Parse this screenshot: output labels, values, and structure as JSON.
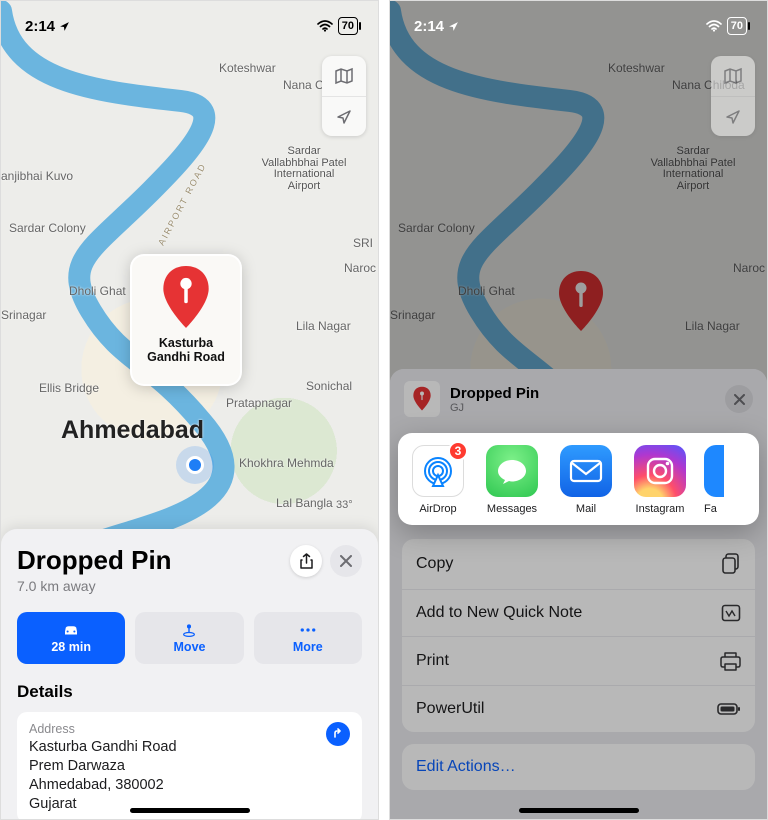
{
  "status": {
    "time": "2:14",
    "battery": "70"
  },
  "map": {
    "city": "Ahmedabad",
    "pin_label_1": "Kasturba",
    "pin_label_2": "Gandhi Road",
    "temp": "33°",
    "airport_label": "Sardar Vallabhbhai Patel International Airport",
    "airport_road": "AIRPORT ROAD",
    "towns": {
      "koteshwar": "Koteshwar",
      "chiloda": "Nana Chiloda",
      "sardar_colony": "Sardar Colony",
      "sri": "SRI",
      "naroc": "Naroc",
      "dholi": "Dholi Ghat",
      "srinagar": "Srinagar",
      "lila": "Lila Nagar",
      "anjibhai": "anjibhai Kuvo",
      "ellis": "Ellis Bridge",
      "pratap": "Pratapnagar",
      "sonichal": "Sonichal",
      "khokhra": "Khokhra Mehmda",
      "lalbangla": "Lal Bangla"
    }
  },
  "place": {
    "title": "Dropped Pin",
    "distance": "7.0 km away",
    "drive_eta": "28 min",
    "move_label": "Move",
    "more_label": "More",
    "details_heading": "Details",
    "address_label": "Address",
    "address_l1": "Kasturba Gandhi Road",
    "address_l2": "Prem Darwaza",
    "address_l3": "Ahmedabad, 380002",
    "address_l4": "Gujarat"
  },
  "share": {
    "title": "Dropped Pin",
    "subtitle": "GJ",
    "apps": {
      "airdrop": "AirDrop",
      "airdrop_badge": "3",
      "messages": "Messages",
      "mail": "Mail",
      "instagram": "Instagram",
      "partial": "Fa"
    },
    "actions": {
      "copy": "Copy",
      "quicknote": "Add to New Quick Note",
      "print": "Print",
      "powerutil": "PowerUtil",
      "edit": "Edit Actions…"
    }
  }
}
